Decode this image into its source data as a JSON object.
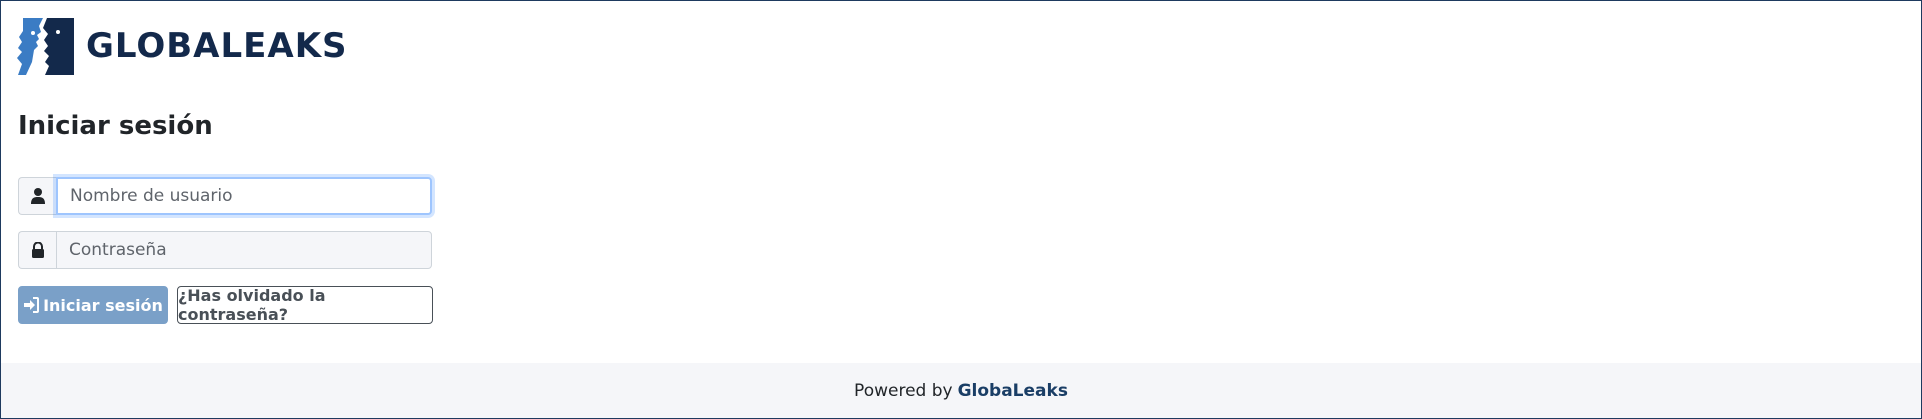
{
  "brand": {
    "logo_text": "GLOBALEAKS",
    "logo_icon": "two-faces-whisper-logo",
    "colors": {
      "primary": "#13294b",
      "accent": "#3b7cc4"
    }
  },
  "login": {
    "title": "Iniciar sesión",
    "username_placeholder": "Nombre de usuario",
    "password_placeholder": "Contraseña",
    "username_icon": "user-icon",
    "password_icon": "lock-icon",
    "submit_label": "Iniciar sesión",
    "submit_icon": "sign-in-icon",
    "forgot_label": "¿Has olvidado la contraseña?",
    "submit_color": "#7aa0c8"
  },
  "footer": {
    "powered_by": "Powered by",
    "brand_link": "GlobaLeaks"
  }
}
